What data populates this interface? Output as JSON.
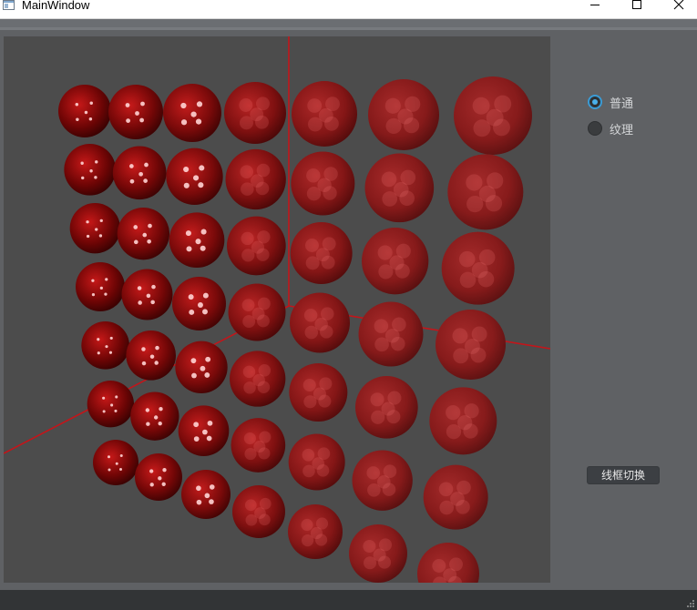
{
  "window": {
    "title": "MainWindow"
  },
  "controls": {
    "radio_normal": "普通",
    "radio_texture": "纹理",
    "selected": "普通",
    "wireframe_button": "线框切换"
  },
  "scene": {
    "background": "#4c4c4c",
    "axis_color": "#c3151a",
    "sphere_color": "#b01818",
    "grid": "7 columns x 7 rows of spheres",
    "render_mode": "普通"
  }
}
